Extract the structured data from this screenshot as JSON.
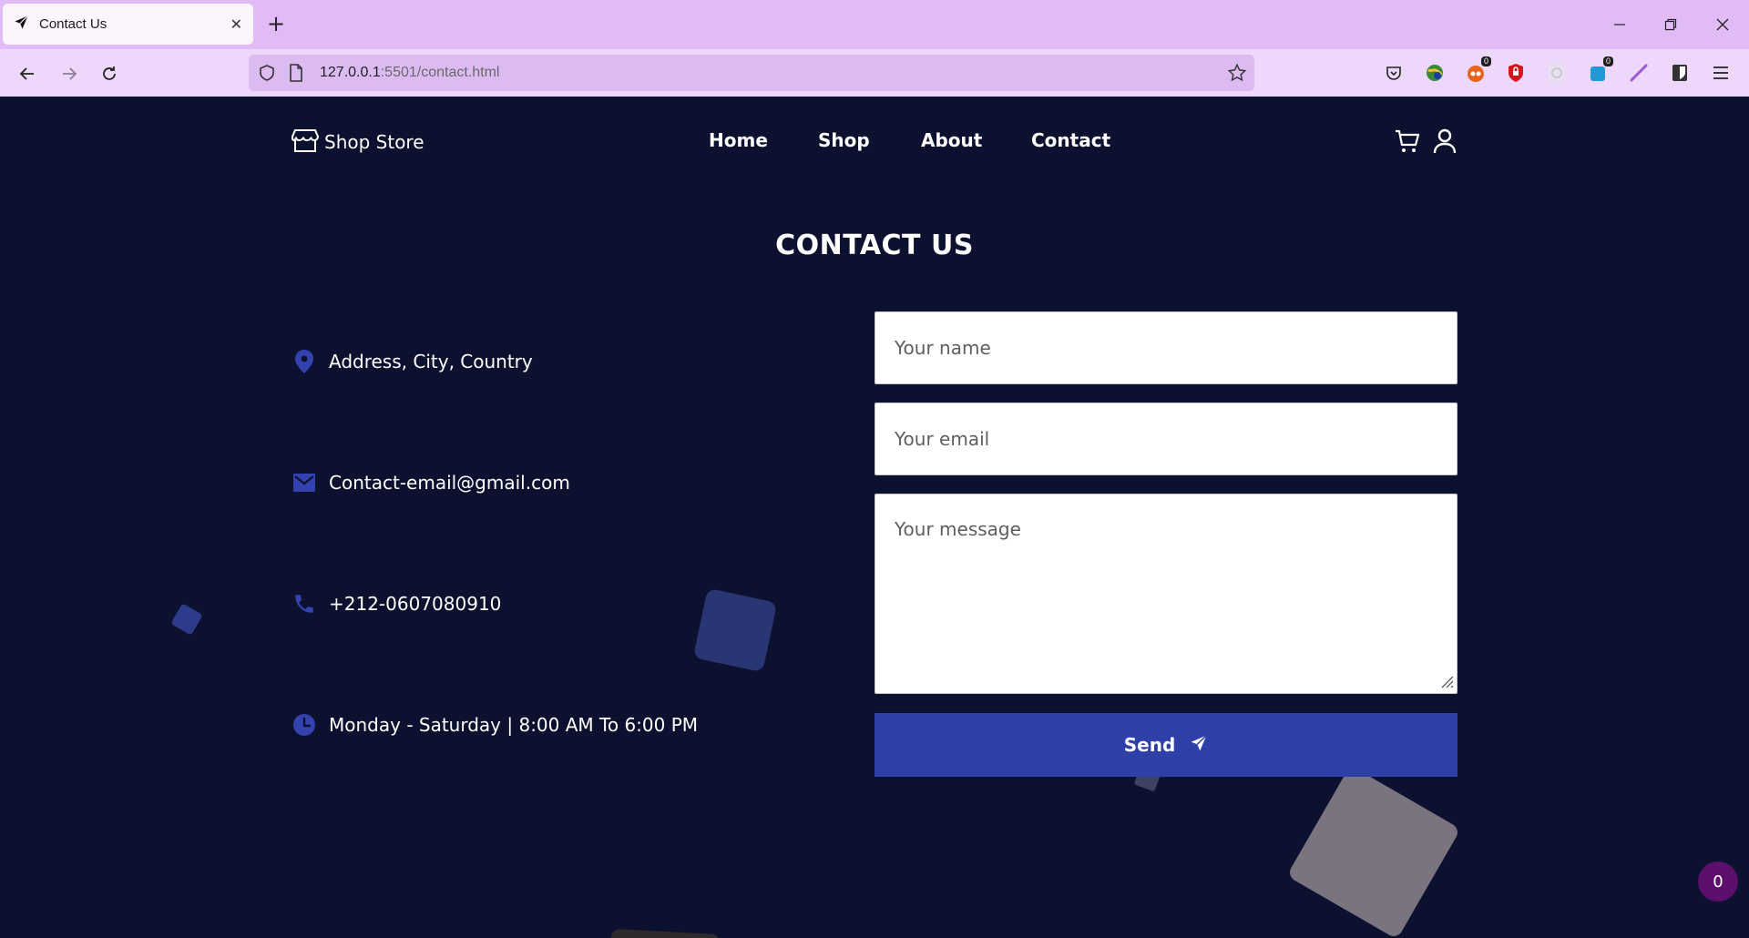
{
  "browser": {
    "tab_title": "Contact Us",
    "tab_close": "✕",
    "new_tab": "+",
    "url_host": "127.0.0.1",
    "url_rest": ":5501/contact.html",
    "extensions": [
      {
        "icon": "pocket-icon",
        "badge": ""
      },
      {
        "icon": "earth-extension-icon",
        "badge": ""
      },
      {
        "icon": "tampermonkey-icon",
        "badge": "0"
      },
      {
        "icon": "ublock-icon",
        "badge": ""
      },
      {
        "icon": "gray-extension-icon",
        "badge": ""
      },
      {
        "icon": "blue-extension-icon",
        "badge": "0"
      },
      {
        "icon": "pen-extension-icon",
        "badge": ""
      },
      {
        "icon": "bitwarden-icon",
        "badge": ""
      }
    ]
  },
  "header": {
    "logo": "Shop Store",
    "nav": [
      "Home",
      "Shop",
      "About",
      "Contact"
    ]
  },
  "page": {
    "title": "CONTACT US",
    "info": {
      "address": "Address, City, Country",
      "email": "Contact-email@gmail.com",
      "phone": "+212-0607080910",
      "hours": "Monday - Saturday | 8:00 AM To 6:00 PM"
    },
    "form": {
      "name_placeholder": "Your name",
      "email_placeholder": "Your email",
      "message_placeholder": "Your message",
      "send_label": "Send"
    },
    "counter": "0"
  },
  "colors": {
    "page_bg": "#0d1130",
    "accent": "#2f3fa8",
    "tab_bar": "#e0bbf5",
    "counter_bg": "#5b0f6a"
  }
}
